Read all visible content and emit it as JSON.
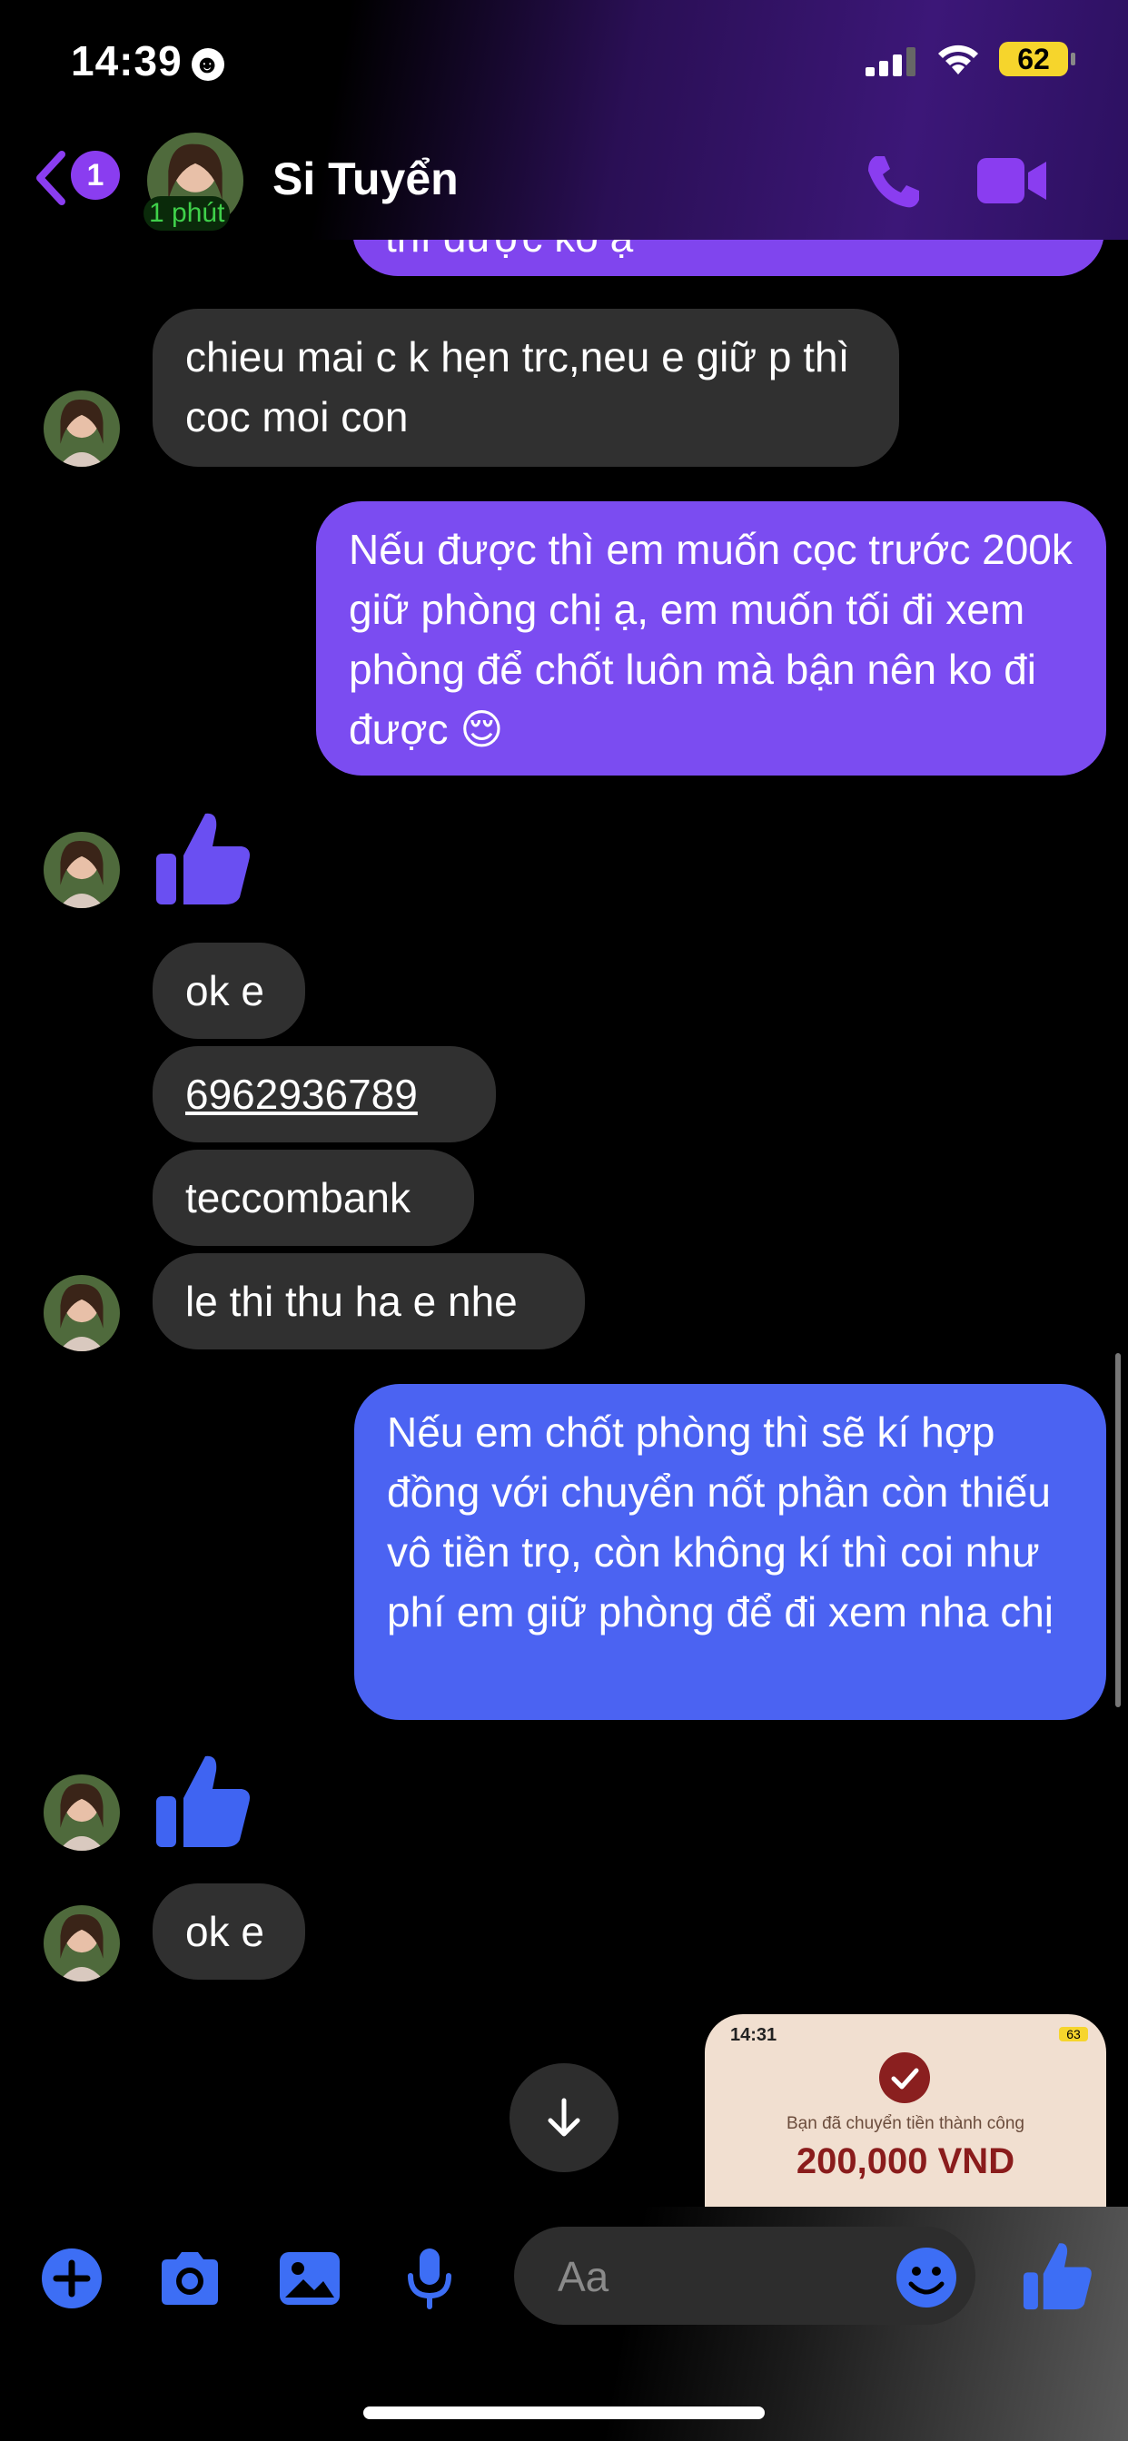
{
  "status_bar": {
    "time": "14:39",
    "battery": "62"
  },
  "header": {
    "back_badge": "1",
    "active_status": "1 phút",
    "contact_name": "Si Tuyển"
  },
  "messages": [
    {
      "side": "out",
      "text": "thì được ko ạ"
    },
    {
      "side": "in",
      "text": "chieu mai c k hẹn trc,neu e giữ p thì coc moi con"
    },
    {
      "side": "out",
      "text": "Nếu được thì em muốn cọc trước 200k giữ phòng chị ạ, em muốn tối đi xem phòng để chốt luôn mà bận nên ko đi được 😌"
    },
    {
      "side": "in",
      "text": "ok e"
    },
    {
      "side": "in",
      "text": "6962936789"
    },
    {
      "side": "in",
      "text": "teccombank"
    },
    {
      "side": "in",
      "text": "le thi thu ha e nhe"
    },
    {
      "side": "out",
      "text": "Nếu em chốt phòng thì sẽ kí hợp đồng với chuyển nốt phần còn thiếu vô tiền trọ, còn không kí thì coi như phí em giữ phòng để đi xem nha chị"
    },
    {
      "side": "in",
      "text": "ok e"
    }
  ],
  "receipt": {
    "time": "14:31",
    "battery": "63",
    "caption": "Bạn đã chuyển tiền thành công",
    "amount": "200,000 VND"
  },
  "composer": {
    "placeholder": "Aa"
  },
  "colors": {
    "accent_purple": "#8a3df0",
    "bubble_out_purple": "#7e4cf0",
    "bubble_out_blue": "#4a64f2",
    "bubble_in": "#303030",
    "toolbar_blue": "#3d6ef5"
  }
}
